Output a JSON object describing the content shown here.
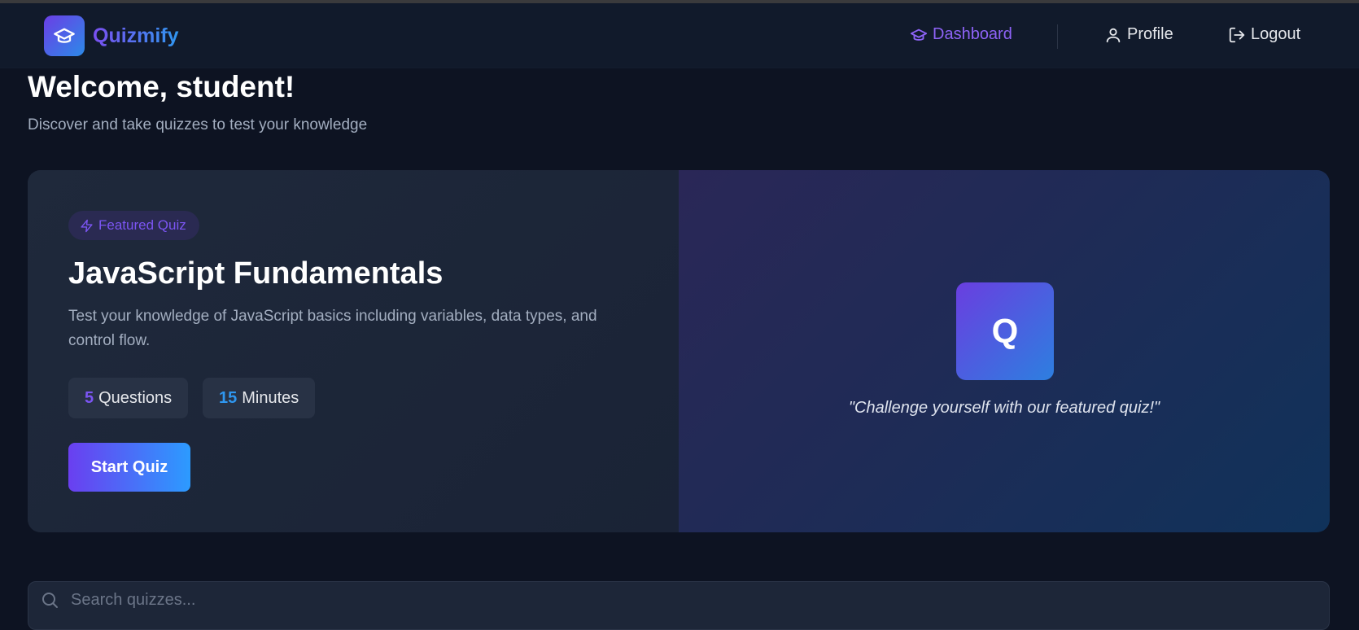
{
  "app": {
    "name": "Quizmify",
    "logo_icon": "graduation-cap-icon"
  },
  "nav": {
    "dashboard": "Dashboard",
    "profile": "Profile",
    "logout": "Logout"
  },
  "header": {
    "title": "Welcome, student!",
    "subtitle": "Discover and take quizzes to test your knowledge"
  },
  "featured": {
    "badge": "Featured Quiz",
    "title": "JavaScript Fundamentals",
    "description": "Test your knowledge of JavaScript basics including variables, data types, and control flow.",
    "questions_count": "5",
    "questions_label": "Questions",
    "minutes_count": "15",
    "minutes_label": "Minutes",
    "start_button": "Start Quiz",
    "tile_letter": "Q",
    "quote": "\"Challenge yourself with our featured quiz!\""
  },
  "search": {
    "placeholder": "Search quizzes..."
  },
  "colors": {
    "accent_purple": "#7b55f2",
    "accent_blue": "#2f97f0",
    "background": "#0d1322"
  }
}
